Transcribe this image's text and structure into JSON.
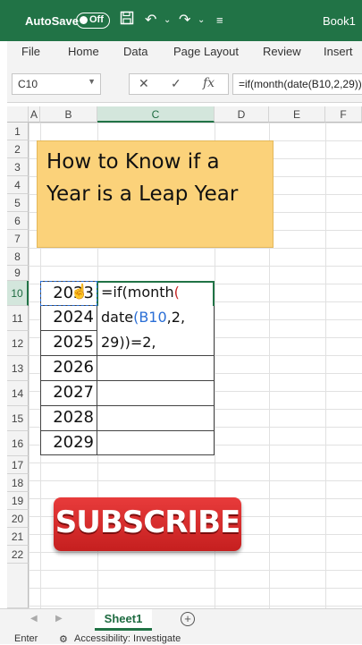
{
  "titlebar": {
    "autosave": "AutoSave",
    "toggle": "Off",
    "workbook": "Book1"
  },
  "menu": [
    "File",
    "Home",
    "Data",
    "Page Layout",
    "Review",
    "Insert"
  ],
  "formula_bar": {
    "name_box": "C10",
    "formula": "=if(month(date(B10,2,29))=2,"
  },
  "columns": [
    "A",
    "B",
    "C",
    "D",
    "E",
    "F"
  ],
  "rows": [
    "1",
    "2",
    "3",
    "4",
    "5",
    "6",
    "7",
    "8",
    "9",
    "10",
    "11",
    "12",
    "13",
    "14",
    "15",
    "16",
    "17",
    "18",
    "19",
    "20",
    "21",
    "22"
  ],
  "title_box": {
    "line1": "How to Know if a",
    "line2": "Year is a Leap Year"
  },
  "years": [
    "2023",
    "2024",
    "2025",
    "2026",
    "2027",
    "2028",
    "2029"
  ],
  "formula_cell": {
    "l1a": "=if(month",
    "l1b": "(",
    "l2a": "date",
    "l2b": "(",
    "l2c": "B10",
    "l2d": ",2,",
    "l3": "29))=2,"
  },
  "subscribe": "SUBSCRIBE",
  "sheet": {
    "tab": "Sheet1"
  },
  "status": {
    "mode": "Enter",
    "accessibility": "Accessibility: Investigate"
  }
}
